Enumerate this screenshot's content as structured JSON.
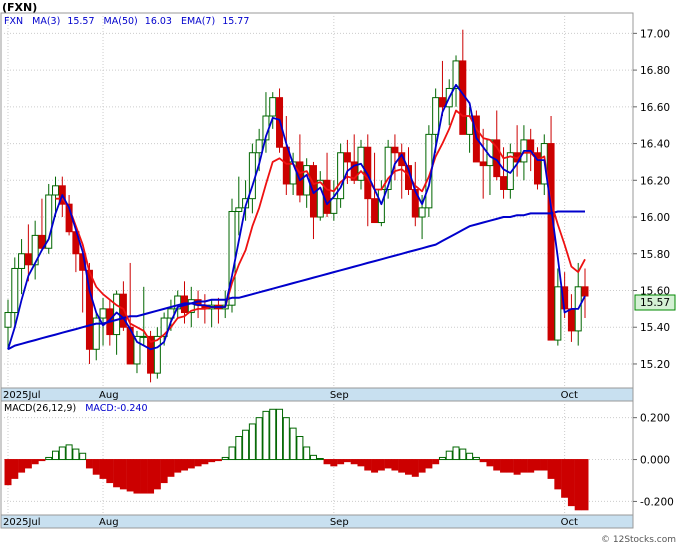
{
  "symbol_title": "(FXN)",
  "legend_main": {
    "symbol": "FXN",
    "items": [
      {
        "label": "MA(3)",
        "value": "15.57",
        "color": "#0000cc"
      },
      {
        "label": "MA(50)",
        "value": "16.03",
        "color": "#0000cc"
      },
      {
        "label": "EMA(7)",
        "value": "15.77",
        "color": "#0000cc"
      }
    ]
  },
  "legend_macd": {
    "label": "MACD(26,12,9)",
    "value_label": "MACD:-0.240"
  },
  "last_price_badge": "15.57",
  "watermark": "© 12Stocks.com",
  "colors": {
    "up": "#006600",
    "down": "#cc0000",
    "ma_fast": "#0000cc",
    "ma_slow": "#0000cc",
    "ema": "#ee1111",
    "date_strip": "#c8e0f0",
    "badge": "#d4f0d4"
  },
  "chart_data": [
    {
      "type": "candlestick",
      "title": "(FXN)",
      "x_tick_labels": [
        "2025Jul",
        "Aug",
        "Sep",
        "Oct"
      ],
      "x_tick_index": [
        0,
        14,
        48,
        82
      ],
      "ylim": [
        15.08,
        17.1
      ],
      "y_ticks": [
        15.2,
        15.4,
        15.6,
        15.8,
        16.0,
        16.2,
        16.4,
        16.6,
        16.8,
        17.0
      ],
      "y_tick_labels": [
        "15.20",
        "15.40",
        "15.60",
        "15.80",
        "16.00",
        "16.20",
        "16.40",
        "16.60",
        "16.80",
        "17.00"
      ],
      "grid": true,
      "ohlc": [
        [
          15.4,
          15.55,
          15.28,
          15.48
        ],
        [
          15.48,
          15.78,
          15.4,
          15.72
        ],
        [
          15.72,
          15.88,
          15.58,
          15.8
        ],
        [
          15.8,
          15.96,
          15.65,
          15.74
        ],
        [
          15.74,
          15.98,
          15.66,
          15.9
        ],
        [
          15.9,
          16.1,
          15.82,
          15.83
        ],
        [
          15.83,
          16.18,
          15.8,
          16.12
        ],
        [
          16.12,
          16.22,
          16.0,
          16.17
        ],
        [
          16.17,
          16.22,
          16.0,
          16.07
        ],
        [
          16.07,
          16.12,
          15.9,
          15.92
        ],
        [
          15.92,
          15.95,
          15.7,
          15.8
        ],
        [
          15.8,
          15.82,
          15.48,
          15.71
        ],
        [
          15.71,
          15.75,
          15.2,
          15.28
        ],
        [
          15.28,
          15.48,
          15.22,
          15.45
        ],
        [
          15.45,
          15.56,
          15.3,
          15.5
        ],
        [
          15.5,
          15.55,
          15.3,
          15.36
        ],
        [
          15.36,
          15.6,
          15.25,
          15.58
        ],
        [
          15.58,
          15.65,
          15.38,
          15.4
        ],
        [
          15.4,
          15.75,
          15.22,
          15.2
        ],
        [
          15.2,
          15.38,
          15.15,
          15.35
        ],
        [
          15.35,
          15.62,
          15.3,
          15.35
        ],
        [
          15.35,
          15.38,
          15.1,
          15.15
        ],
        [
          15.15,
          15.4,
          15.12,
          15.35
        ],
        [
          15.35,
          15.48,
          15.3,
          15.45
        ],
        [
          15.45,
          15.55,
          15.38,
          15.5
        ],
        [
          15.5,
          15.6,
          15.45,
          15.57
        ],
        [
          15.57,
          15.65,
          15.42,
          15.48
        ],
        [
          15.48,
          15.62,
          15.4,
          15.55
        ],
        [
          15.55,
          15.6,
          15.45,
          15.52
        ],
        [
          15.52,
          15.58,
          15.42,
          15.5
        ],
        [
          15.5,
          15.55,
          15.4,
          15.52
        ],
        [
          15.52,
          15.56,
          15.42,
          15.5
        ],
        [
          15.5,
          15.6,
          15.45,
          15.52
        ],
        [
          15.52,
          16.1,
          15.48,
          16.03
        ],
        [
          16.03,
          16.22,
          15.9,
          16.05
        ],
        [
          16.05,
          16.2,
          15.98,
          16.1
        ],
        [
          16.1,
          16.4,
          16.02,
          16.35
        ],
        [
          16.35,
          16.48,
          16.25,
          16.42
        ],
        [
          16.42,
          16.68,
          16.35,
          16.55
        ],
        [
          16.55,
          16.68,
          16.48,
          16.65
        ],
        [
          16.65,
          16.7,
          16.35,
          16.38
        ],
        [
          16.38,
          16.55,
          16.12,
          16.18
        ],
        [
          16.18,
          16.35,
          16.12,
          16.3
        ],
        [
          16.3,
          16.45,
          16.08,
          16.12
        ],
        [
          16.12,
          16.32,
          16.05,
          16.28
        ],
        [
          16.28,
          16.3,
          15.88,
          16.0
        ],
        [
          16.0,
          16.25,
          15.98,
          16.2
        ],
        [
          16.2,
          16.35,
          16.0,
          16.02
        ],
        [
          16.02,
          16.2,
          15.98,
          16.1
        ],
        [
          16.1,
          16.4,
          16.05,
          16.35
        ],
        [
          16.35,
          16.42,
          16.18,
          16.3
        ],
        [
          16.3,
          16.45,
          16.18,
          16.2
        ],
        [
          16.2,
          16.42,
          16.15,
          16.38
        ],
        [
          16.38,
          16.45,
          15.95,
          16.1
        ],
        [
          16.1,
          16.35,
          16.02,
          15.97
        ],
        [
          15.97,
          16.2,
          15.95,
          16.15
        ],
        [
          16.15,
          16.42,
          16.1,
          16.38
        ],
        [
          16.38,
          16.45,
          16.2,
          16.35
        ],
        [
          16.35,
          16.4,
          16.1,
          16.28
        ],
        [
          16.28,
          16.38,
          16.12,
          16.15
        ],
        [
          16.15,
          16.3,
          15.95,
          16.0
        ],
        [
          16.0,
          16.12,
          15.88,
          16.05
        ],
        [
          16.05,
          16.5,
          16.0,
          16.45
        ],
        [
          16.45,
          16.7,
          16.35,
          16.65
        ],
        [
          16.65,
          16.85,
          16.55,
          16.6
        ],
        [
          16.6,
          16.75,
          16.5,
          16.7
        ],
        [
          16.7,
          16.88,
          16.6,
          16.85
        ],
        [
          16.85,
          17.02,
          16.62,
          16.45
        ],
        [
          16.45,
          16.6,
          16.35,
          16.55
        ],
        [
          16.55,
          16.58,
          16.4,
          16.3
        ],
        [
          16.3,
          16.48,
          16.1,
          16.28
        ],
        [
          16.28,
          16.4,
          16.12,
          16.42
        ],
        [
          16.42,
          16.58,
          16.2,
          16.22
        ],
        [
          16.22,
          16.38,
          16.1,
          16.15
        ],
        [
          16.15,
          16.4,
          16.1,
          16.35
        ],
        [
          16.35,
          16.5,
          16.22,
          16.3
        ],
        [
          16.3,
          16.5,
          16.2,
          16.42
        ],
        [
          16.42,
          16.48,
          16.25,
          16.35
        ],
        [
          16.35,
          16.38,
          16.15,
          16.18
        ],
        [
          16.18,
          16.45,
          16.12,
          16.4
        ],
        [
          16.4,
          16.55,
          15.85,
          15.33
        ],
        [
          15.33,
          15.72,
          15.3,
          15.62
        ],
        [
          15.62,
          15.7,
          15.45,
          15.5
        ],
        [
          15.5,
          15.58,
          15.32,
          15.38
        ],
        [
          15.38,
          15.75,
          15.3,
          15.62
        ],
        [
          15.62,
          15.72,
          15.45,
          15.57
        ]
      ],
      "series": [
        {
          "name": "MA(3)",
          "values": [
            15.28,
            15.4,
            15.55,
            15.68,
            15.75,
            15.82,
            15.88,
            16.02,
            16.12,
            16.05,
            15.93,
            15.81,
            15.6,
            15.48,
            15.41,
            15.44,
            15.48,
            15.45,
            15.39,
            15.32,
            15.3,
            15.28,
            15.29,
            15.32,
            15.43,
            15.51,
            15.52,
            15.53,
            15.52,
            15.52,
            15.51,
            15.51,
            15.51,
            15.68,
            15.87,
            16.06,
            16.17,
            16.29,
            16.44,
            16.54,
            16.53,
            16.4,
            16.29,
            16.2,
            16.23,
            16.13,
            16.16,
            16.07,
            16.11,
            16.16,
            16.25,
            16.28,
            16.29,
            16.23,
            16.15,
            16.07,
            16.17,
            16.29,
            16.34,
            16.26,
            16.14,
            16.07,
            16.17,
            16.38,
            16.57,
            16.65,
            16.72,
            16.67,
            16.62,
            16.43,
            16.38,
            16.33,
            16.31,
            16.26,
            16.24,
            16.29,
            16.36,
            16.36,
            16.31,
            16.31,
            16.05,
            15.78,
            15.48,
            15.5,
            15.5,
            15.57
          ]
        },
        {
          "name": "MA(50)",
          "values": [
            15.28,
            15.3,
            15.31,
            15.32,
            15.33,
            15.34,
            15.35,
            15.36,
            15.37,
            15.38,
            15.39,
            15.4,
            15.41,
            15.42,
            15.42,
            15.43,
            15.44,
            15.45,
            15.46,
            15.46,
            15.47,
            15.48,
            15.49,
            15.5,
            15.51,
            15.52,
            15.53,
            15.53,
            15.54,
            15.54,
            15.55,
            15.55,
            15.55,
            15.56,
            15.56,
            15.57,
            15.58,
            15.59,
            15.6,
            15.61,
            15.62,
            15.63,
            15.64,
            15.65,
            15.66,
            15.67,
            15.68,
            15.69,
            15.7,
            15.71,
            15.72,
            15.73,
            15.74,
            15.75,
            15.76,
            15.77,
            15.78,
            15.79,
            15.8,
            15.81,
            15.82,
            15.83,
            15.84,
            15.85,
            15.87,
            15.89,
            15.91,
            15.93,
            15.95,
            15.96,
            15.97,
            15.98,
            15.99,
            16.0,
            16.0,
            16.01,
            16.01,
            16.02,
            16.02,
            16.02,
            16.02,
            16.03,
            16.03,
            16.03,
            16.03,
            16.03
          ]
        },
        {
          "name": "EMA(7)",
          "values": [
            null,
            null,
            null,
            null,
            null,
            null,
            null,
            16.1,
            16.1,
            16.05,
            15.95,
            15.85,
            15.7,
            15.62,
            15.58,
            15.55,
            15.52,
            15.5,
            15.42,
            15.4,
            15.38,
            15.32,
            15.33,
            15.36,
            15.4,
            15.45,
            15.46,
            15.49,
            15.5,
            15.5,
            15.51,
            15.51,
            15.51,
            15.64,
            15.74,
            15.82,
            15.95,
            16.05,
            16.18,
            16.3,
            16.32,
            16.29,
            16.29,
            16.24,
            16.25,
            16.18,
            16.19,
            16.15,
            16.14,
            16.19,
            16.22,
            16.21,
            16.25,
            16.21,
            16.15,
            16.15,
            16.21,
            16.25,
            16.26,
            16.23,
            16.17,
            16.14,
            16.22,
            16.33,
            16.4,
            16.48,
            16.58,
            16.55,
            16.55,
            16.48,
            16.43,
            16.42,
            16.38,
            16.32,
            16.33,
            16.32,
            16.35,
            16.35,
            16.31,
            16.33,
            16.08,
            15.96,
            15.85,
            15.73,
            15.7,
            15.77
          ]
        }
      ]
    },
    {
      "type": "bar",
      "title": "MACD(26,12,9)",
      "x_tick_labels": [
        "2025Jul",
        "Aug",
        "Sep",
        "Oct"
      ],
      "ylim": [
        -0.26,
        0.27
      ],
      "y_ticks": [
        -0.2,
        0.0,
        0.2
      ],
      "y_tick_labels": [
        "-0.200",
        "0.000",
        "0.200"
      ],
      "grid": true,
      "series": [
        {
          "name": "MACD",
          "values": [
            -0.12,
            -0.09,
            -0.06,
            -0.04,
            -0.02,
            -0.005,
            0.01,
            0.04,
            0.06,
            0.07,
            0.05,
            0.03,
            -0.04,
            -0.07,
            -0.09,
            -0.11,
            -0.13,
            -0.14,
            -0.15,
            -0.16,
            -0.16,
            -0.16,
            -0.14,
            -0.11,
            -0.08,
            -0.06,
            -0.05,
            -0.04,
            -0.03,
            -0.02,
            -0.01,
            -0.005,
            0.01,
            0.06,
            0.11,
            0.14,
            0.17,
            0.2,
            0.23,
            0.24,
            0.24,
            0.2,
            0.15,
            0.11,
            0.06,
            0.02,
            0.005,
            -0.02,
            -0.03,
            -0.02,
            -0.01,
            -0.02,
            -0.03,
            -0.05,
            -0.06,
            -0.05,
            -0.04,
            -0.05,
            -0.06,
            -0.07,
            -0.08,
            -0.06,
            -0.04,
            -0.02,
            0.01,
            0.04,
            0.06,
            0.05,
            0.03,
            0.01,
            -0.01,
            -0.03,
            -0.05,
            -0.06,
            -0.06,
            -0.07,
            -0.06,
            -0.06,
            -0.05,
            -0.05,
            -0.09,
            -0.14,
            -0.18,
            -0.22,
            -0.24,
            -0.24
          ]
        }
      ]
    }
  ]
}
